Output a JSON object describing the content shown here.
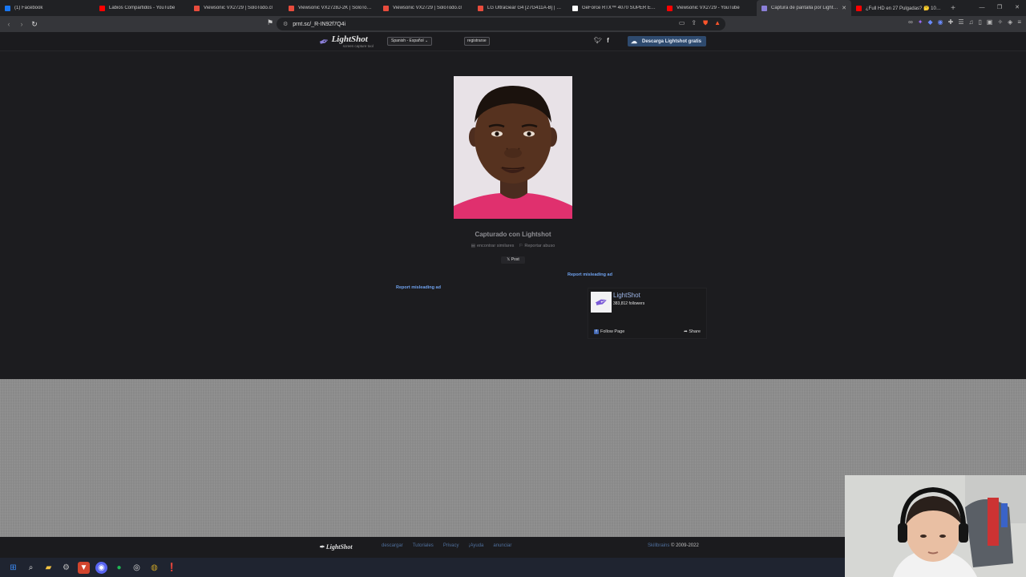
{
  "browser": {
    "tabs": [
      {
        "title": "(1) Facebook",
        "icon_color": "#1877f2"
      },
      {
        "title": "Labios Compartidos - YouTube",
        "icon_color": "#ff0000"
      },
      {
        "title": "Viewsonic VX2729 | SoloTodo.cl",
        "icon_color": "#e84c3d"
      },
      {
        "title": "Viewsonic VX2728J-2K | SoloTodo.cl",
        "icon_color": "#e84c3d"
      },
      {
        "title": "Viewsonic VX2729 | SoloTodo.cl",
        "icon_color": "#e84c3d"
      },
      {
        "title": "LG UltraGear G4 [27G411A-B] | SoloTodo.cl",
        "icon_color": "#e84c3d"
      },
      {
        "title": "GeForce RTX™ 4070 SUPER EX Gamer",
        "icon_color": "#ffffff"
      },
      {
        "title": "Viewsonic VX2729 - YouTube",
        "icon_color": "#ff0000"
      },
      {
        "title": "Captura de pantalla por Lightshot",
        "icon_color": "#8b7fd8",
        "active": true
      },
      {
        "title": "¿Full HD en 27 Pulgadas? 🤔 1080p",
        "icon_color": "#ff0000"
      }
    ],
    "new_tab": "+",
    "url": "prnt.sc/_R-IN92f7Q4i"
  },
  "lightshot": {
    "logo": "LightShot",
    "tagline": "screen capture tool",
    "language": "Spanish - Español",
    "register": "registrarse",
    "download": "Descarga Lightshot gratis",
    "caption": "Capturado con Lightshot",
    "find_similar": "encontrar similares",
    "report_abuse": "Reportar abuso",
    "post": "Post",
    "report_ad_right": "Report misleading ad",
    "report_ad_left": "Report misleading ad",
    "fb": {
      "name": "LightShot",
      "followers": "383,812 followers",
      "follow": "Follow Page",
      "share": "Share"
    },
    "footer": {
      "logo": "LightShot",
      "links": [
        "descargar",
        "Tutoriales",
        "Privacy",
        "¡Ayuda",
        "anunciar"
      ],
      "company": "Skillbrains",
      "copyright": " © 2009-2022"
    }
  },
  "colors": {
    "page_bg": "#1c1c1f",
    "accent_link": "#6fa2ef",
    "download_btn": "#2e4a6e",
    "photo_shirt": "#e0306e"
  }
}
